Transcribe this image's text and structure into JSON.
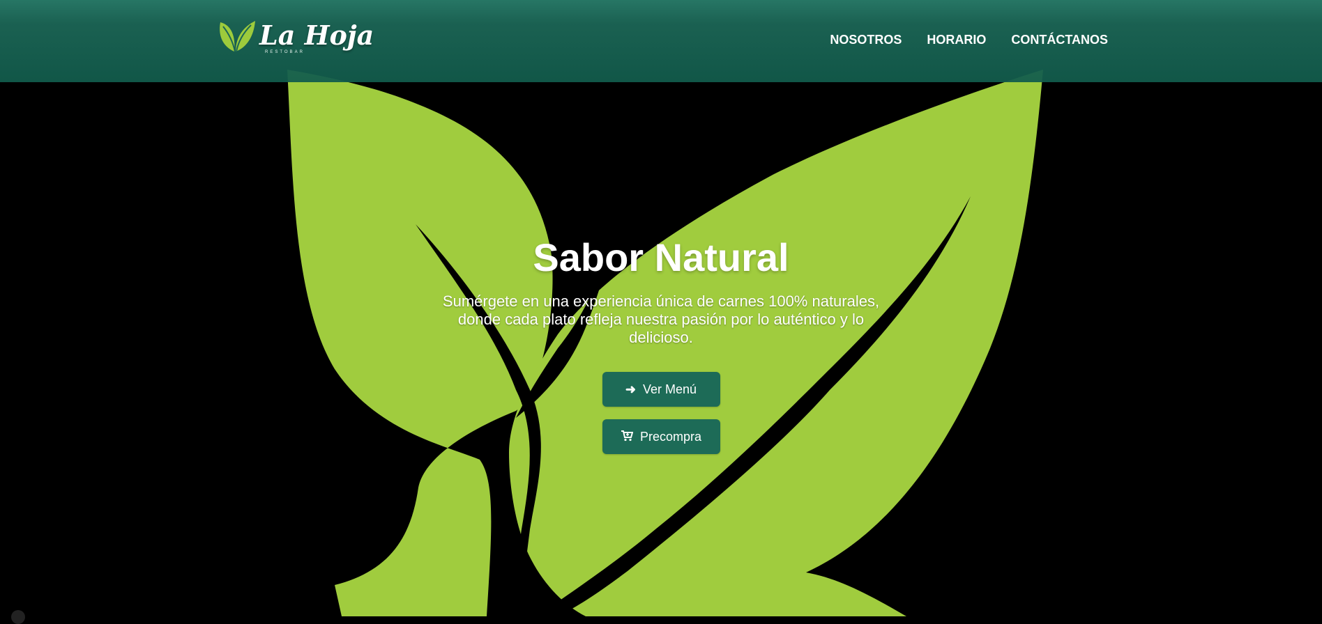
{
  "brand": {
    "name": "La Hoja",
    "subtitle": "RESTOBAR",
    "logo_icon": "leaf-icon"
  },
  "nav": {
    "items": [
      {
        "label": "NOSOTROS"
      },
      {
        "label": "HORARIO"
      },
      {
        "label": "CONTÁCTANOS"
      }
    ]
  },
  "hero": {
    "title": "Sabor Natural",
    "text": "Sumérgete en una experiencia única de carnes 100% naturales, donde cada plato refleja nuestra pasión por lo auténtico y lo delicioso.",
    "buttons": [
      {
        "label": "Ver Menú",
        "icon": "arrow-right-icon"
      },
      {
        "label": "Precompra",
        "icon": "cart-icon"
      }
    ]
  },
  "colors": {
    "navbar": "#1c6656",
    "button": "#1d6b57",
    "leaf": "#a0cc3e",
    "background": "#000000"
  }
}
